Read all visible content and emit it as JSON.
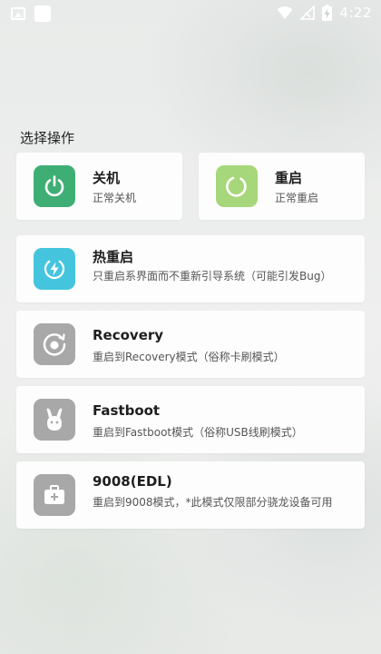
{
  "status_bar": {
    "time": "4:22",
    "left_icons": [
      "gallery-icon",
      "app-square-icon"
    ],
    "right_icons": [
      "wifi-icon",
      "signal-off-icon",
      "battery-charging-icon"
    ]
  },
  "section_title": "选择操作",
  "actions": {
    "power_off": {
      "title": "关机",
      "desc": "正常关机",
      "icon": "power-icon",
      "color": "#3fae74"
    },
    "reboot": {
      "title": "重启",
      "desc": "正常重启",
      "icon": "refresh-icon",
      "color": "#a6d77a"
    },
    "hot_reboot": {
      "title": "热重启",
      "desc": "只重启系界面而不重新引导系统（可能引发Bug）",
      "icon": "bolt-icon",
      "color": "#45c5dd"
    },
    "recovery": {
      "title": "Recovery",
      "desc": "重启到Recovery模式（俗称卡刷模式）",
      "icon": "recovery-icon",
      "color": "#a8a8a8"
    },
    "fastboot": {
      "title": "Fastboot",
      "desc": "重启到Fastboot模式（俗称USB线刷模式）",
      "icon": "bunny-icon",
      "color": "#a8a8a8"
    },
    "edl": {
      "title": "9008(EDL)",
      "desc": "重启到9008模式，*此模式仅限部分骁龙设备可用",
      "icon": "toolbox-icon",
      "color": "#a8a8a8"
    }
  }
}
